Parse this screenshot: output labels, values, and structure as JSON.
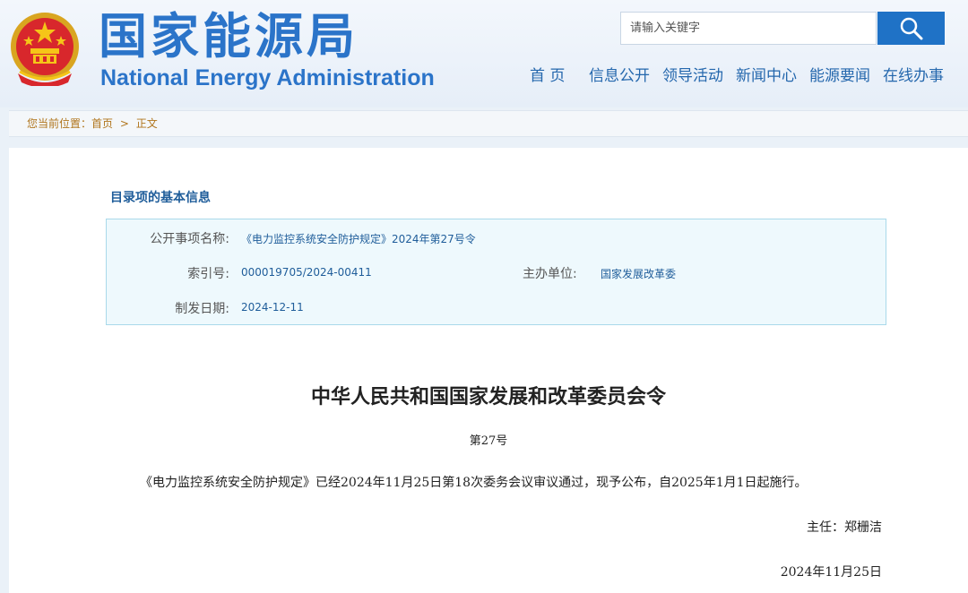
{
  "header": {
    "logo_cn": "国家能源局",
    "logo_en": "National Energy Administration",
    "search_placeholder": "请输入关键字",
    "nav": [
      "首 页",
      "信息公开",
      "领导活动",
      "新闻中心",
      "能源要闻",
      "在线办事"
    ]
  },
  "breadcrumb": {
    "prefix": "您当前位置：",
    "home": "首页",
    "separator": ">",
    "current": "正文"
  },
  "info": {
    "section_title": "目录项的基本信息",
    "name_label": "公开事项名称:",
    "name_value": "《电力监控系统安全防护规定》2024年第27号令",
    "index_label": "索引号:",
    "index_value": "000019705/2024-00411",
    "sponsor_label": "主办单位:",
    "sponsor_value": "国家发展改革委",
    "date_label": "制发日期:",
    "date_value": "2024-12-11"
  },
  "document": {
    "title": "中华人民共和国国家发展和改革委员会令",
    "number": "第27号",
    "body": "《电力监控系统安全防护规定》已经2024年11月25日第18次委务会议审议通过，现予公布，自2025年1月1日起施行。",
    "signature": "主任：郑栅洁",
    "date": "2024年11月25日"
  },
  "colors": {
    "brand_blue": "#2b74c9",
    "search_button": "#1f72c6",
    "breadcrumb_text": "#b0751c",
    "info_box_bg": "#eef9fd"
  }
}
